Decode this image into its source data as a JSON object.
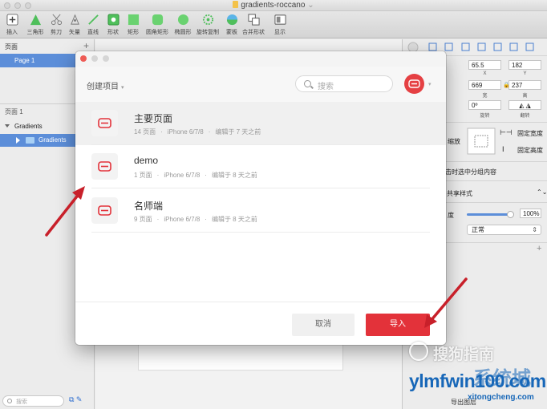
{
  "window": {
    "title": "gradients-roccano"
  },
  "toolbar": {
    "items": [
      {
        "label": "插入"
      },
      {
        "label": "三角形"
      },
      {
        "label": "剪刀"
      },
      {
        "label": "矢量"
      },
      {
        "label": "直线"
      },
      {
        "label": "形状"
      },
      {
        "label": "矩形"
      },
      {
        "label": "圆角矩形"
      },
      {
        "label": "椭圆形"
      },
      {
        "label": "旋转复制"
      },
      {
        "label": "蒙板"
      },
      {
        "label": "合并形状"
      },
      {
        "label": "显示"
      }
    ]
  },
  "left_panel": {
    "pages_header": "页面",
    "page_item": "Page 1",
    "sub_header": "页面 1",
    "tree_root": "Gradients",
    "tree_child": "Gradients",
    "search_placeholder": "搜索"
  },
  "inspector": {
    "x": "65.5",
    "y": "182",
    "x_label": "X",
    "y_label": "Y",
    "w": "669",
    "h": "237",
    "w_label": "宽",
    "h_label": "高",
    "rotate": "0º",
    "rotate_label": "旋转",
    "flip_label": "翻转",
    "resize_label": "缩放",
    "fix_width": "固定宽度",
    "fix_height": "固定高度",
    "group_text": "击时选中分组内容",
    "shared_style": "共享样式",
    "opacity_label": "度",
    "opacity_value": "100%",
    "opacity_fraction": 0.97,
    "blend": "正常",
    "footer": "导出图层"
  },
  "dialog": {
    "create_label": "创建项目",
    "search_placeholder": "搜索",
    "projects": [
      {
        "name": "主要页面",
        "pages": "14 页面",
        "device": "iPhone 6/7/8",
        "edited": "编辑于 7 天之前",
        "selected": true
      },
      {
        "name": "demo",
        "pages": "1 页面",
        "device": "iPhone 6/7/8",
        "edited": "编辑于 8 天之前",
        "selected": false
      },
      {
        "name": "名师端",
        "pages": "9 页面",
        "device": "iPhone 6/7/8",
        "edited": "编辑于 8 天之前",
        "selected": false
      }
    ],
    "cancel_label": "取消",
    "import_label": "导入",
    "dot_separator": "·"
  },
  "watermark": {
    "line1": "搜狗指南",
    "line2": "ylmfwin100.com",
    "line3": "xitongcheng.com",
    "line4": "系统城"
  },
  "colors": {
    "accent_red": "#e3323a",
    "selection_blue": "#5c8ed9",
    "arrow_red": "#c8202a"
  }
}
